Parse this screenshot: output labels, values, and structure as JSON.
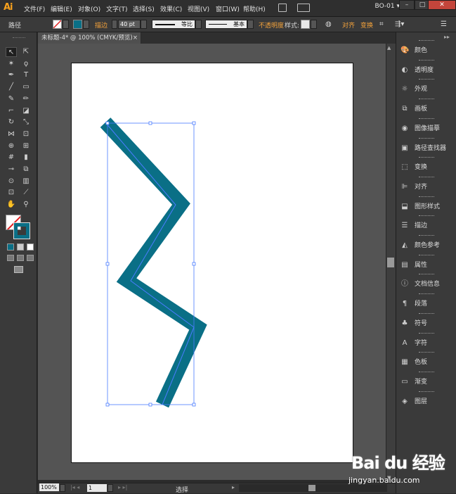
{
  "app": {
    "logo": "Ai",
    "workspace": "BO-01"
  },
  "menu": [
    "文件(F)",
    "编辑(E)",
    "对象(O)",
    "文字(T)",
    "选择(S)",
    "效果(C)",
    "视图(V)",
    "窗口(W)",
    "帮助(H)"
  ],
  "window_controls": {
    "minimize": "–",
    "maximize": "□",
    "close": "✕"
  },
  "control_bar": {
    "object_label": "路径",
    "stroke_label": "描边",
    "stroke_weight": "40 pt",
    "profile_label": "等比",
    "brush_label": "基本",
    "opacity_label": "不透明度",
    "style_label": "样式:",
    "align_label": "对齐",
    "transform_label": "变换"
  },
  "document": {
    "tab_title": "未标题-4* @ 100% (CMYK/预览)",
    "close": "×"
  },
  "shape": {
    "stroke_color": "#0a6f86",
    "selection_color": "#4a7cff"
  },
  "status": {
    "zoom": "100%",
    "page": "1",
    "mode": "选择"
  },
  "panels": [
    {
      "icon": "color-icon",
      "glyph": "🎨",
      "label": "颜色"
    },
    {
      "icon": "transparency-icon",
      "glyph": "◐",
      "label": "透明度"
    },
    {
      "icon": "appearance-icon",
      "glyph": "☼",
      "label": "外观"
    },
    {
      "icon": "artboards-icon",
      "glyph": "⧉",
      "label": "画板"
    },
    {
      "icon": "image-trace-icon",
      "glyph": "◉",
      "label": "图像描摹"
    },
    {
      "icon": "pathfinder-icon",
      "glyph": "▣",
      "label": "路径查找器"
    },
    {
      "icon": "transform-icon",
      "glyph": "⬚",
      "label": "变换"
    },
    {
      "icon": "align-icon",
      "glyph": "⊫",
      "label": "对齐"
    },
    {
      "icon": "graphic-styles-icon",
      "glyph": "⬓",
      "label": "图形样式"
    },
    {
      "icon": "stroke-icon",
      "glyph": "☰",
      "label": "描边"
    },
    {
      "icon": "color-guide-icon",
      "glyph": "◭",
      "label": "颜色参考"
    },
    {
      "icon": "attributes-icon",
      "glyph": "▤",
      "label": "属性"
    },
    {
      "icon": "document-info-icon",
      "glyph": "ⓘ",
      "label": "文档信息"
    },
    {
      "icon": "paragraph-icon",
      "glyph": "¶",
      "label": "段落"
    },
    {
      "icon": "symbols-icon",
      "glyph": "♣",
      "label": "符号"
    },
    {
      "icon": "character-icon",
      "glyph": "A",
      "label": "字符"
    },
    {
      "icon": "swatches-icon",
      "glyph": "▦",
      "label": "色板"
    },
    {
      "icon": "gradient-icon",
      "glyph": "▭",
      "label": "渐变"
    },
    {
      "icon": "layers-icon",
      "glyph": "◈",
      "label": "图层"
    }
  ],
  "watermark": {
    "logo": "Bai du 经验",
    "url": "jingyan.baidu.com"
  }
}
